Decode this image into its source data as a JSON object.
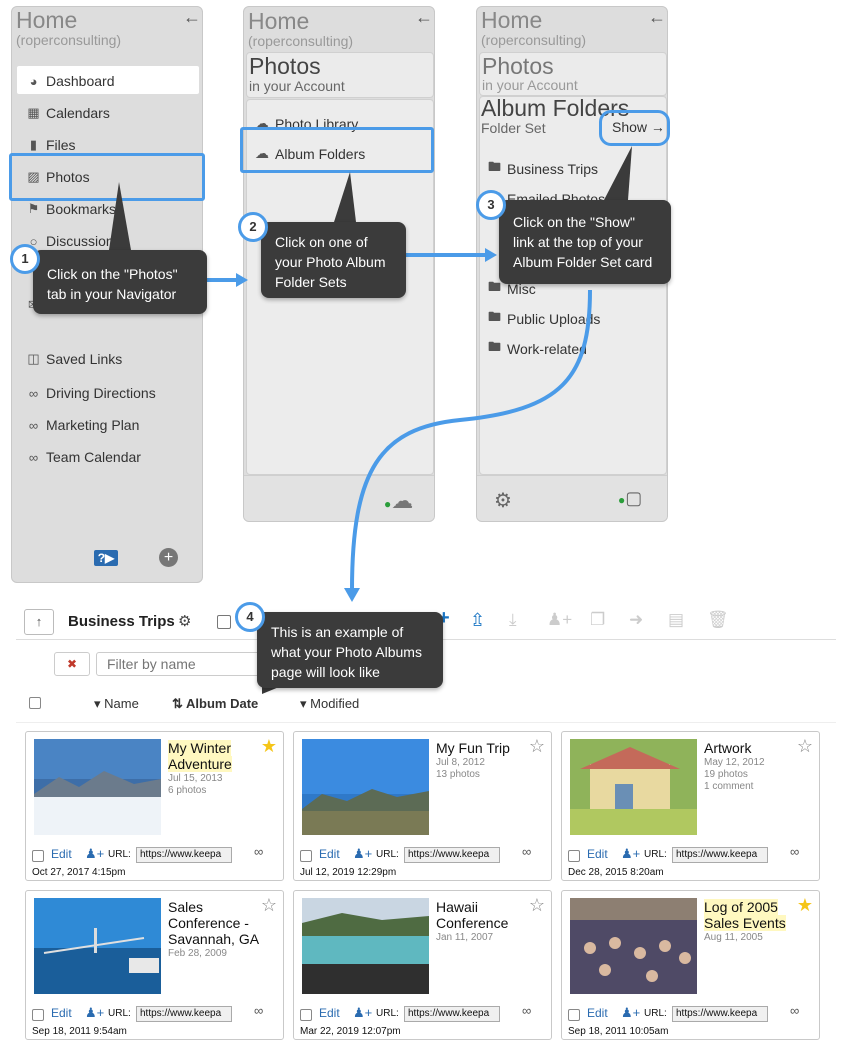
{
  "nav": {
    "title": "Home",
    "subtitle": "(roperconsulting)",
    "items": [
      {
        "label": "Dashboard",
        "icon": "dashboard-icon"
      },
      {
        "label": "Calendars",
        "icon": "calendar-icon"
      },
      {
        "label": "Files",
        "icon": "file-icon"
      },
      {
        "label": "Photos",
        "icon": "photo-book-icon"
      },
      {
        "label": "Bookmarks",
        "icon": "bookmark-icon"
      },
      {
        "label": "Discussion",
        "icon": "discussion-icon"
      },
      {
        "label": "Saved Links",
        "icon": "folder-open-icon"
      },
      {
        "label": "Driving Directions",
        "icon": "link-icon"
      },
      {
        "label": "Marketing Plan",
        "icon": "link-icon"
      },
      {
        "label": "Team Calendar",
        "icon": "link-icon"
      }
    ]
  },
  "panel2": {
    "title": "Home",
    "subtitle": "(roperconsulting)",
    "card_title": "Photos",
    "card_sub": "in your Account",
    "items": [
      "Photo Library",
      "Album Folders"
    ]
  },
  "panel3": {
    "title": "Home",
    "subtitle": "(roperconsulting)",
    "card1_title": "Photos",
    "card1_sub": "in your Account",
    "card2_title": "Album Folders",
    "card2_sub": "Folder Set",
    "show_label": "Show →",
    "folders": [
      "Business Trips",
      "Emailed Photos",
      "Misc",
      "Public Uploads",
      "Work-related"
    ]
  },
  "callouts": {
    "c1": {
      "num": "1",
      "text": "Click on the \"Photos\" tab in your Navigator"
    },
    "c2": {
      "num": "2",
      "text": "Click on one of your Photo Album Folder Sets"
    },
    "c3": {
      "num": "3",
      "text": "Click on the \"Show\" link at the top of your Album Folder Set card"
    },
    "c4": {
      "num": "4",
      "text": "This is an example of what your Photo Albums page will look like"
    }
  },
  "albums_page": {
    "up_label": "↑",
    "title": "Business Trips",
    "filter_placeholder": "Filter by name",
    "clear_label": "✖",
    "sort": {
      "name": "Name",
      "album_date": "Album Date",
      "modified": "Modified"
    }
  },
  "colors": {
    "accent": "#4b9be8",
    "callout": "#3b3b3b",
    "star": "#f5c518",
    "highlight": "#fff8c0"
  },
  "albums": [
    {
      "name": "My Winter Adventure",
      "date": "Jul 15, 2013",
      "photos": "6 photos",
      "comment": "",
      "starred": true,
      "highlight": true,
      "modified": "Oct 27, 2017 4:15pm"
    },
    {
      "name": "My Fun Trip",
      "date": "Jul 8, 2012",
      "photos": "13 photos",
      "comment": "",
      "starred": false,
      "highlight": false,
      "modified": "Jul 12, 2019 12:29pm"
    },
    {
      "name": "Artwork",
      "date": "May 12, 2012",
      "photos": "19 photos",
      "comment": "1 comment",
      "starred": false,
      "highlight": false,
      "modified": "Dec 28, 2015 8:20am"
    },
    {
      "name": "Sales Conference - Savannah, GA",
      "date": "Feb 28, 2009",
      "photos": "",
      "comment": "",
      "starred": false,
      "highlight": false,
      "modified": "Sep 18, 2011 9:54am"
    },
    {
      "name": "Hawaii Conference",
      "date": "Jan 11, 2007",
      "photos": "",
      "comment": "",
      "starred": false,
      "highlight": false,
      "modified": "Mar 22, 2019 12:07pm"
    },
    {
      "name": "Log of 2005 Sales Events",
      "date": "Aug 11, 2005",
      "photos": "",
      "comment": "",
      "starred": true,
      "highlight": true,
      "modified": "Sep 18, 2011 10:05am"
    }
  ],
  "album_labels": {
    "edit": "Edit",
    "url": "URL:",
    "url_value": "https://www.keepa"
  }
}
